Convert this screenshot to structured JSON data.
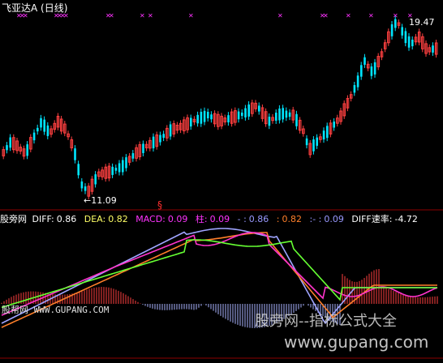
{
  "window": {
    "title": "飞亚达A (日线)"
  },
  "main_chart": {
    "low_marker": "←11.09",
    "high_marker": "19.47",
    "signal_glyph": "§",
    "star_glyph": "✕",
    "colors": {
      "up": "#ff4040",
      "down": "#00e5ff",
      "marker": "#ff33ff"
    }
  },
  "indicator": {
    "name": "股旁网",
    "fields": [
      {
        "label": "DIFF:",
        "value": "0.86",
        "color": "#ffffff"
      },
      {
        "label": "DEA:",
        "value": "0.82",
        "color": "#ffff66"
      },
      {
        "label": "MACD:",
        "value": "0.09",
        "color": "#ff33ff"
      },
      {
        "label": "柱:",
        "value": "0.09",
        "color": "#ff33ff"
      },
      {
        "label": "-  :",
        "value": "0.86",
        "color": "#9999ff"
      },
      {
        "label": ":",
        "value": "0.82",
        "color": "#ff7f2a"
      },
      {
        "label": ":-  :",
        "value": "0.09",
        "color": "#9999ff"
      },
      {
        "label": "DIFF速率:",
        "value": "-4.72",
        "color": "#ffffff"
      }
    ]
  },
  "watermarks": {
    "left": "股帮网 WWW.GUPANG.COM",
    "cn": "股旁网--指标公式大全",
    "url": "www.gupang.com"
  }
}
